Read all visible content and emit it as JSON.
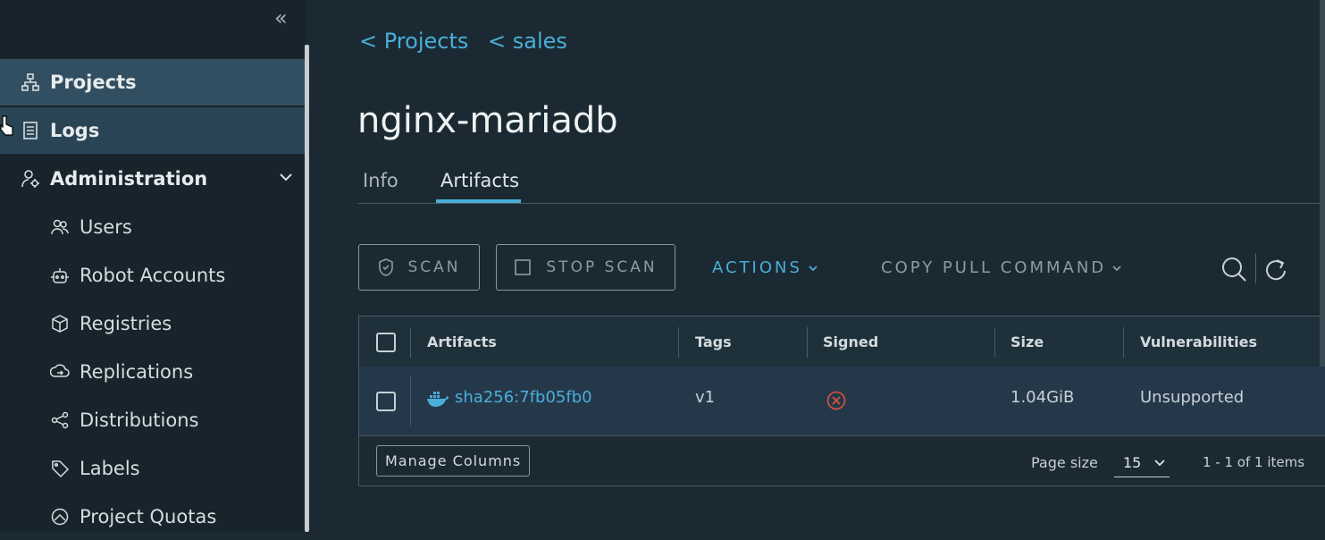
{
  "sidebar": {
    "collapse_icon": "«",
    "items": [
      {
        "label": "Projects",
        "icon": "projects-icon"
      },
      {
        "label": "Logs",
        "icon": "logs-icon"
      },
      {
        "label": "Administration",
        "icon": "admin-icon"
      },
      {
        "label": "Users",
        "icon": "users-icon"
      },
      {
        "label": "Robot Accounts",
        "icon": "robot-icon"
      },
      {
        "label": "Registries",
        "icon": "registries-icon"
      },
      {
        "label": "Replications",
        "icon": "replications-icon"
      },
      {
        "label": "Distributions",
        "icon": "distributions-icon"
      },
      {
        "label": "Labels",
        "icon": "labels-icon"
      },
      {
        "label": "Project Quotas",
        "icon": "quotas-icon"
      }
    ]
  },
  "breadcrumb": [
    "< Projects",
    "< sales"
  ],
  "page_title": "nginx-mariadb",
  "tabs": [
    {
      "label": "Info",
      "active": false
    },
    {
      "label": "Artifacts",
      "active": true
    }
  ],
  "toolbar": {
    "scan_label": "SCAN",
    "stop_scan_label": "STOP SCAN",
    "actions_label": "ACTIONS",
    "copy_pull_label": "COPY PULL COMMAND"
  },
  "grid": {
    "columns": [
      "Artifacts",
      "Tags",
      "Signed",
      "Size",
      "Vulnerabilities"
    ],
    "rows": [
      {
        "artifact": "sha256:7fb05fb0",
        "tags": "v1",
        "signed": false,
        "size": "1.04GiB",
        "vulnerabilities": "Unsupported"
      }
    ],
    "manage_columns_label": "Manage Columns",
    "page_size_label": "Page size",
    "page_size_value": "15",
    "item_count": "1 - 1 of 1 items"
  },
  "colors": {
    "accent": "#4aaed9",
    "sidebar_active": "#324f61",
    "background": "#1b2a32",
    "error": "#e0533b"
  }
}
